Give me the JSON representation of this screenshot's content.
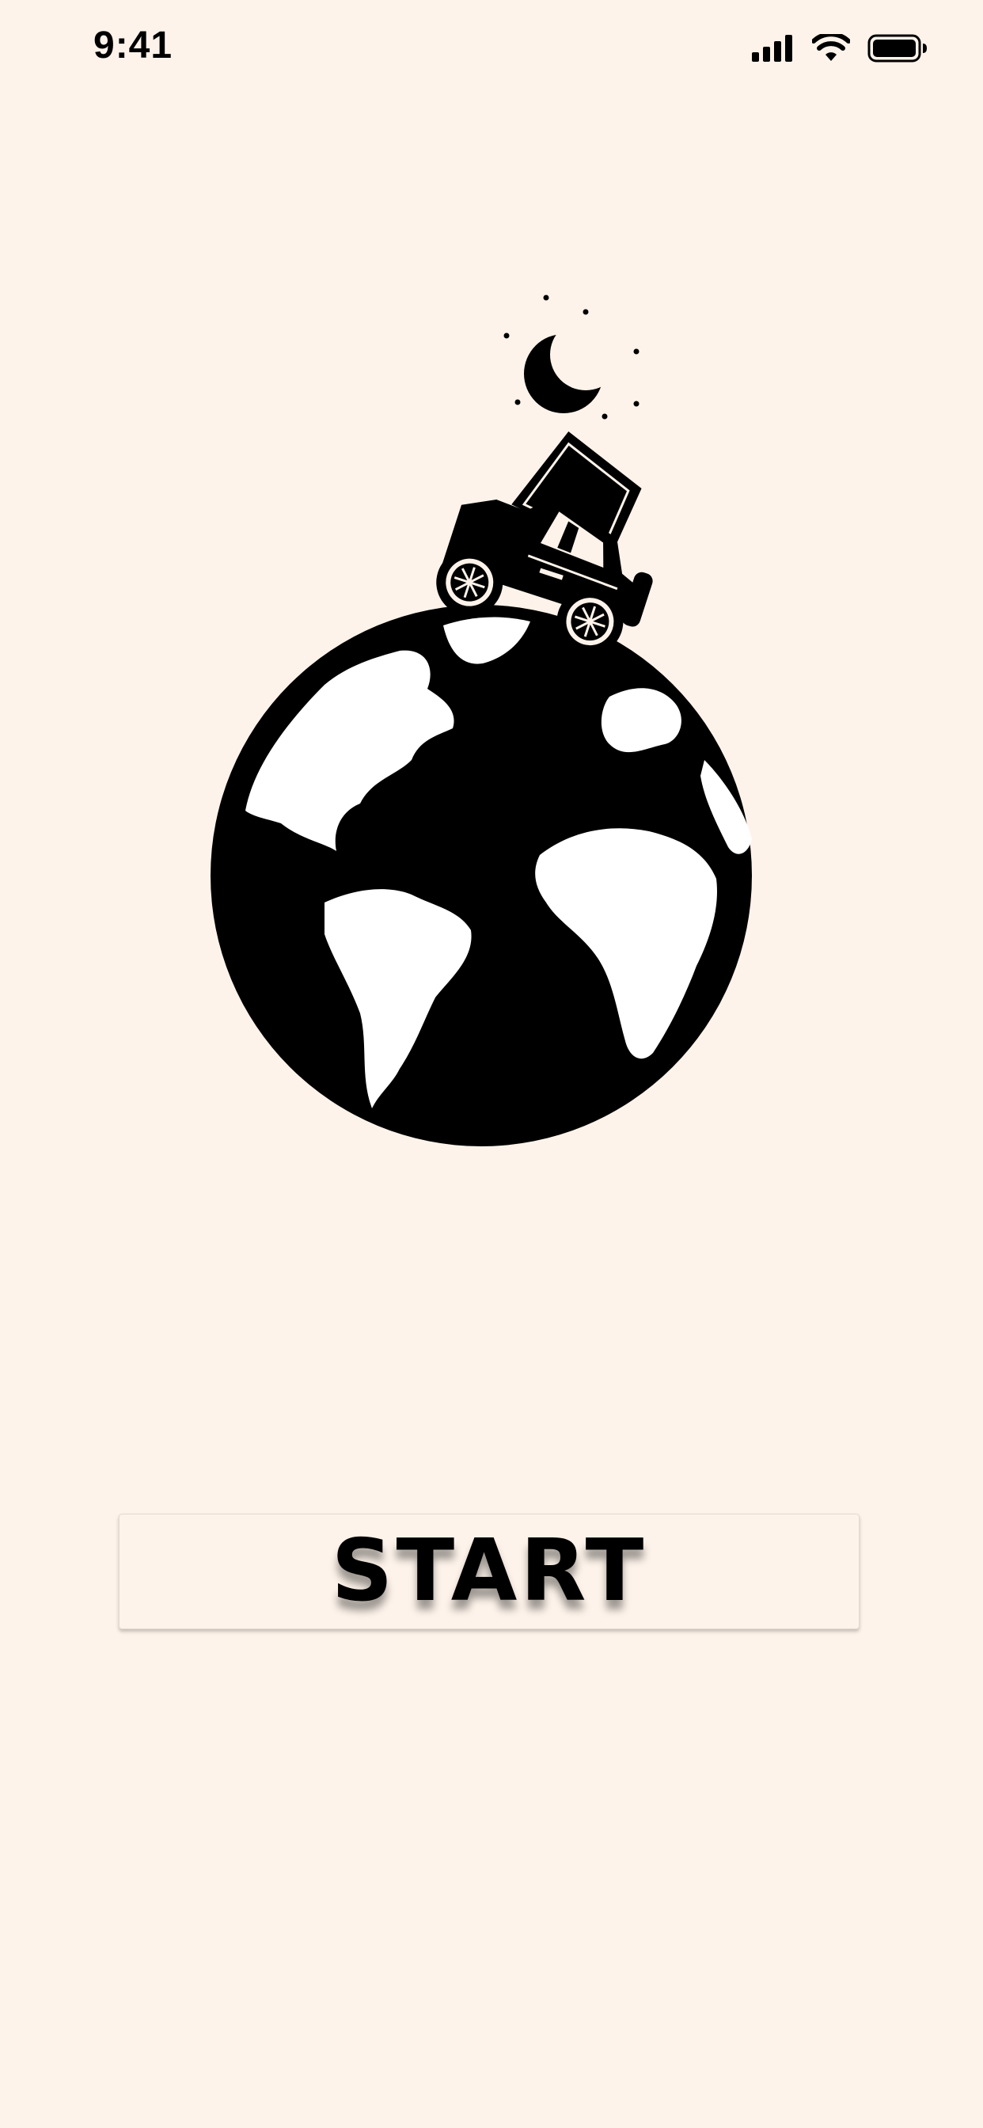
{
  "status_bar": {
    "time": "9:41",
    "icons": [
      "cellular-signal-icon",
      "wifi-icon",
      "battery-icon"
    ]
  },
  "hero": {
    "icons": [
      "moon-icon",
      "stars-icon",
      "jeep-icon",
      "globe-icon"
    ]
  },
  "start_button": {
    "label": "START"
  },
  "colors": {
    "background": "#fdf3ea",
    "foreground": "#000000"
  }
}
